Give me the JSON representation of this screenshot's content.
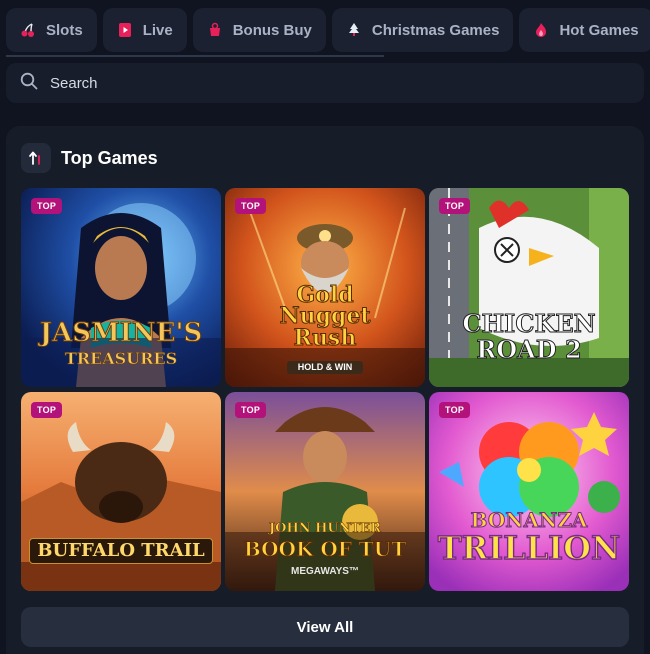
{
  "tabs": [
    {
      "label": "Slots",
      "icon": "cherries-icon"
    },
    {
      "label": "Live",
      "icon": "play-card-icon"
    },
    {
      "label": "Bonus Buy",
      "icon": "bonus-buy-icon"
    },
    {
      "label": "Christmas Games",
      "icon": "christmas-tree-icon"
    },
    {
      "label": "Hot Games",
      "icon": "flame-icon"
    }
  ],
  "search": {
    "placeholder": "Search"
  },
  "top_games": {
    "title": "Top Games",
    "badge": "TOP",
    "games": [
      {
        "line1": "JASMINE'S",
        "line2": "TREASURES"
      },
      {
        "line1": "Gold",
        "line2": "Nugget",
        "line3": "Rush",
        "line4": "HOLD & WIN"
      },
      {
        "line1": "CHICKEN",
        "line2": "ROAD 2"
      },
      {
        "line1": "BUFFALO TRAIL"
      },
      {
        "line1": "JOHN HUNTER",
        "line2": "BOOK OF TUT",
        "line3": "MEGAWAYS™"
      },
      {
        "line1": "BONANZA",
        "line2": "TRILLION"
      }
    ],
    "view_all": "View All"
  },
  "colors": {
    "accent": "#b3127a",
    "background": "#0f1420",
    "panel": "#161c28"
  }
}
